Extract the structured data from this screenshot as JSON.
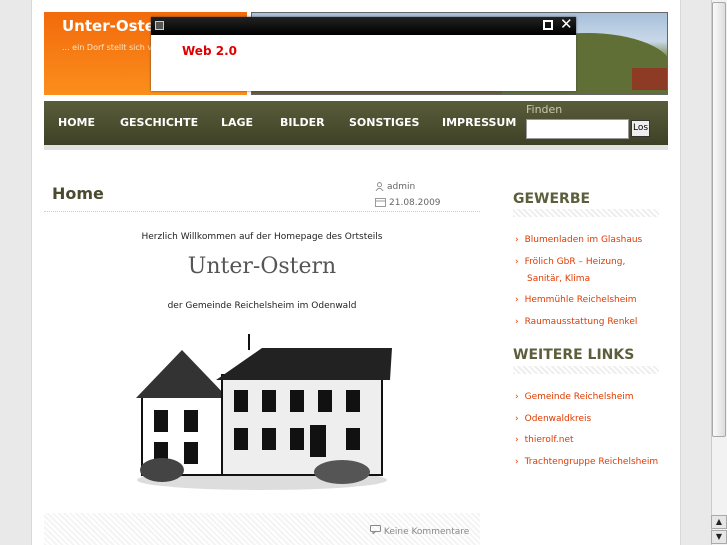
{
  "header": {
    "site_title": "Unter-Ostern",
    "tagline": "... ein Dorf stellt sich vor"
  },
  "popup": {
    "text": "Web 2.0",
    "close_label": "✕"
  },
  "nav": {
    "items": [
      "HOME",
      "GESCHICHTE",
      "LAGE",
      "BILDER",
      "SONSTIGES",
      "IMPRESSUM"
    ],
    "search_label": "Finden",
    "search_value": "",
    "search_button": "Los"
  },
  "post": {
    "title": "Home",
    "author": "admin",
    "date": "21.08.2009",
    "welcome": "Herzlich Willkommen auf der Homepage des Ortsteils",
    "logo_text": "Unter-Ostern",
    "community": "der Gemeinde Reichelsheim im Odenwald",
    "comments": "Keine Kommentare"
  },
  "sidebar": {
    "gewerbe_title": "GEWERBE",
    "gewerbe_links": [
      "Blumenladen im Glashaus",
      "Frölich GbR – Heizung,",
      "Sanitär, Klima",
      "Hemmühle Reichelsheim",
      "Raumausstattung Renkel"
    ],
    "links_title": "WEITERE LINKS",
    "weitere_links": [
      "Gemeinde Reichelsheim",
      "Odenwaldkreis",
      "thierolf.net",
      "Trachtengruppe Reichelsheim"
    ]
  },
  "colors": {
    "accent_orange": "#f26a0c",
    "nav_olive": "#4a4d2e",
    "link_red": "#e03a00"
  }
}
